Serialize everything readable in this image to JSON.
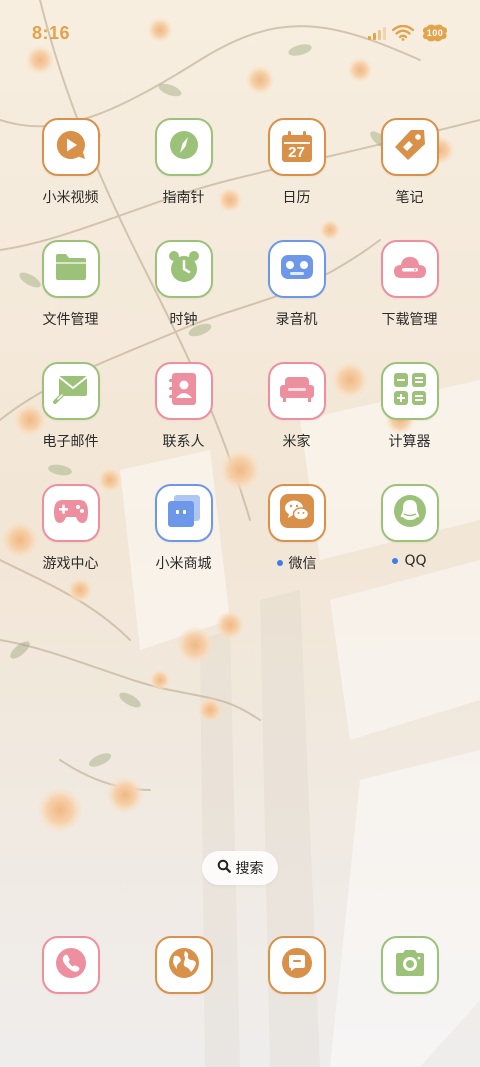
{
  "status_bar": {
    "time": "8:16",
    "battery": "100",
    "icons": [
      "signal-icon",
      "wifi-icon",
      "battery-icon"
    ]
  },
  "colors": {
    "orange": "#d9914a",
    "green": "#9cc27a",
    "pink": "#ee8f9f",
    "blue": "#6d98ea",
    "status": "#e3a34a"
  },
  "apps": [
    {
      "label": "小米视频",
      "icon": "play-icon",
      "color": "orange",
      "badge": false
    },
    {
      "label": "指南针",
      "icon": "compass-icon",
      "color": "green",
      "badge": false
    },
    {
      "label": "日历",
      "icon": "calendar-icon",
      "color": "orange",
      "badge": false,
      "icon_text": "27"
    },
    {
      "label": "笔记",
      "icon": "tag-icon",
      "color": "orange",
      "badge": false
    },
    {
      "label": "文件管理",
      "icon": "folder-icon",
      "color": "green",
      "badge": false
    },
    {
      "label": "时钟",
      "icon": "alarm-clock-icon",
      "color": "green",
      "badge": false
    },
    {
      "label": "录音机",
      "icon": "recorder-icon",
      "color": "blue",
      "badge": false
    },
    {
      "label": "下载管理",
      "icon": "cloud-download-icon",
      "color": "pink",
      "badge": false
    },
    {
      "label": "电子邮件",
      "icon": "mail-icon",
      "color": "green",
      "badge": false
    },
    {
      "label": "联系人",
      "icon": "contacts-book-icon",
      "color": "pink",
      "badge": false
    },
    {
      "label": "米家",
      "icon": "sofa-icon",
      "color": "pink",
      "badge": false
    },
    {
      "label": "计算器",
      "icon": "calculator-icon",
      "color": "green",
      "badge": false
    },
    {
      "label": "游戏中心",
      "icon": "gamepad-icon",
      "color": "pink",
      "badge": false
    },
    {
      "label": "小米商城",
      "icon": "store-bag-icon",
      "color": "blue",
      "badge": false
    },
    {
      "label": "微信",
      "icon": "wechat-icon",
      "color": "orange",
      "badge": true
    },
    {
      "label": "QQ",
      "icon": "qq-penguin-icon",
      "color": "green",
      "badge": true
    }
  ],
  "search": {
    "label": "搜索"
  },
  "dock": [
    {
      "icon": "phone-icon",
      "color": "pink"
    },
    {
      "icon": "browser-globe-icon",
      "color": "orange"
    },
    {
      "icon": "message-icon",
      "color": "orange"
    },
    {
      "icon": "camera-icon",
      "color": "green"
    }
  ]
}
